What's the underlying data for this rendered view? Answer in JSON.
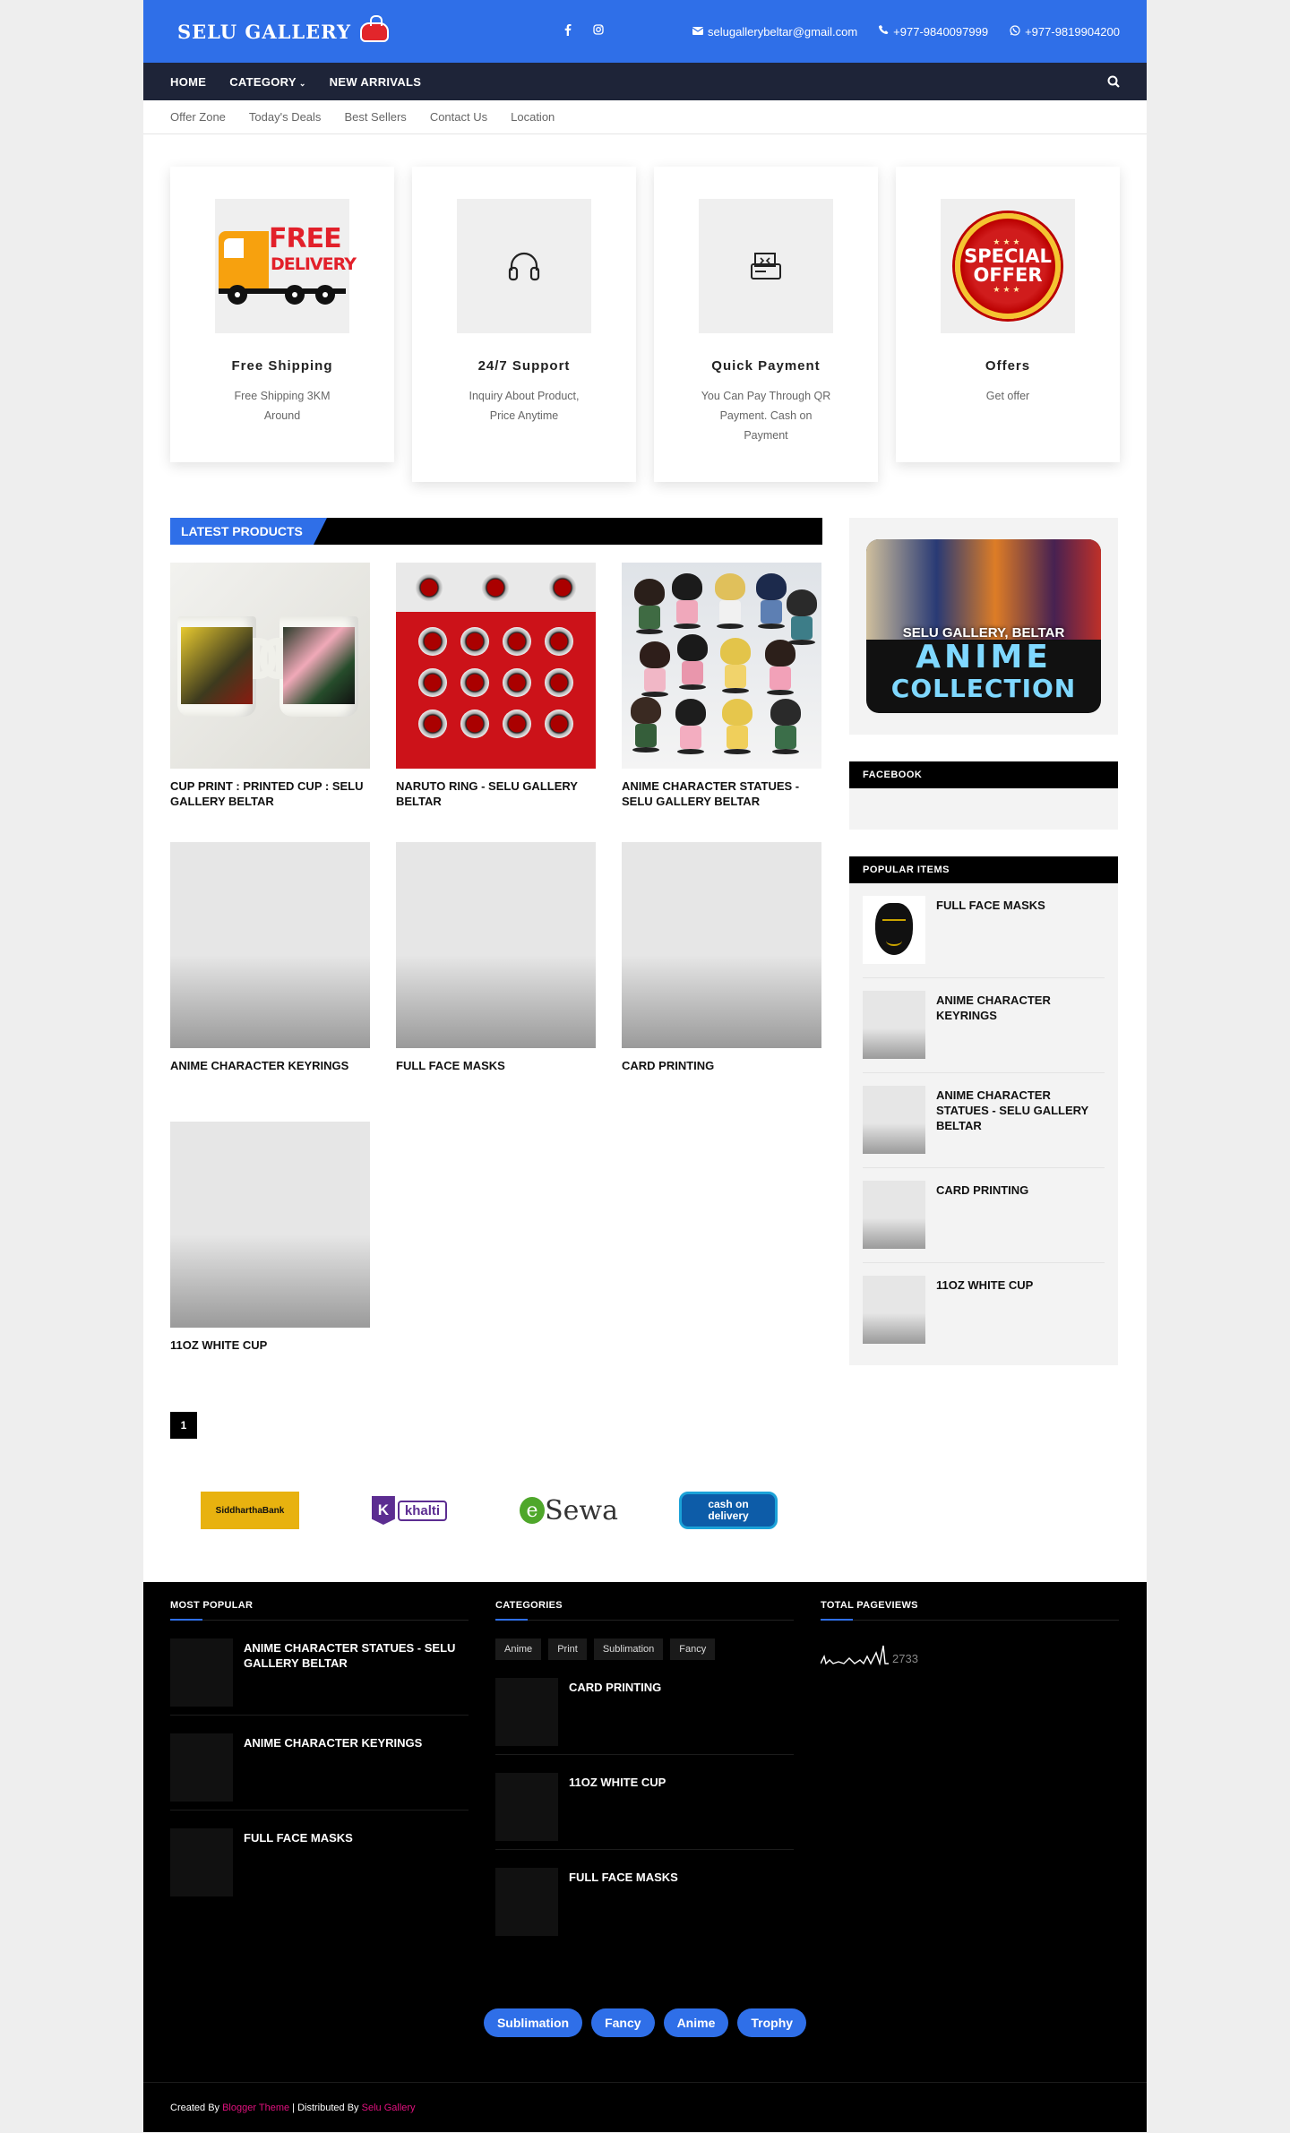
{
  "header": {
    "brand": "SELU GALLERY",
    "email": "selugallerybeltar@gmail.com",
    "phone": "+977-9840097999",
    "whatsapp": "+977-9819904200",
    "accent": "#2f6fe8"
  },
  "nav": {
    "items": [
      "HOME",
      "CATEGORY",
      "NEW ARRIVALS"
    ]
  },
  "subnav": {
    "items": [
      "Offer Zone",
      "Today's Deals",
      "Best Sellers",
      "Contact Us",
      "Location"
    ]
  },
  "features": [
    {
      "title": "Free Shipping",
      "desc": "Free Shipping 3KM Around",
      "badge_top": "FREE",
      "badge_bottom": "DELIVERY"
    },
    {
      "title": "24/7 Support",
      "desc": "Inquiry About Product, Price Anytime"
    },
    {
      "title": "Quick Payment",
      "desc": "You Can Pay Through QR Payment. Cash on Payment"
    },
    {
      "title": "Offers",
      "desc": "Get offer",
      "badge_top": "SPECIAL",
      "badge_bottom": "OFFER"
    }
  ],
  "latest": {
    "heading": "LATEST PRODUCTS",
    "products": [
      "CUP PRINT : PRINTED CUP : SELU GALLERY BELTAR",
      "NARUTO RING - SELU GALLERY BELTAR",
      "ANIME CHARACTER STATUES - SELU GALLERY BELTAR",
      "ANIME CHARACTER KEYRINGS",
      "FULL FACE MASKS",
      "CARD PRINTING",
      "11OZ WHITE CUP"
    ],
    "page": "1"
  },
  "sidebar": {
    "banner_line1": "SELU GALLERY, BELTAR",
    "banner_line2": "ANIME",
    "banner_line3": "COLLECTION",
    "facebook_title": "FACEBOOK",
    "popular_title": "POPULAR ITEMS",
    "popular": [
      "FULL FACE MASKS",
      "ANIME CHARACTER KEYRINGS",
      "ANIME CHARACTER STATUES - SELU GALLERY BELTAR",
      "CARD PRINTING",
      "11OZ WHITE CUP"
    ]
  },
  "payments": {
    "siddhartha": "SiddharthaBank",
    "khalti_k": "K",
    "khalti": "khalti",
    "esewa_e": "e",
    "esewa": "Sewa",
    "cod_line1": "cash on",
    "cod_line2": "delivery"
  },
  "footer": {
    "most_popular_title": "MOST POPULAR",
    "most_popular": [
      "ANIME CHARACTER STATUES - SELU GALLERY BELTAR",
      "ANIME CHARACTER KEYRINGS",
      "FULL FACE MASKS"
    ],
    "categories_title": "CATEGORIES",
    "categories": [
      "Anime",
      "Print",
      "Sublimation",
      "Fancy"
    ],
    "category_posts": [
      "CARD PRINTING",
      "11OZ WHITE CUP",
      "FULL FACE MASKS"
    ],
    "pageviews_title": "TOTAL PAGEVIEWS",
    "pageviews": "2733",
    "bottom_tags": [
      "Sublimation",
      "Fancy",
      "Anime",
      "Trophy"
    ],
    "created_by": "Created By",
    "theme_link": "Blogger Theme",
    "distributed_by": " | Distributed By",
    "distributor_link": "Selu Gallery"
  }
}
